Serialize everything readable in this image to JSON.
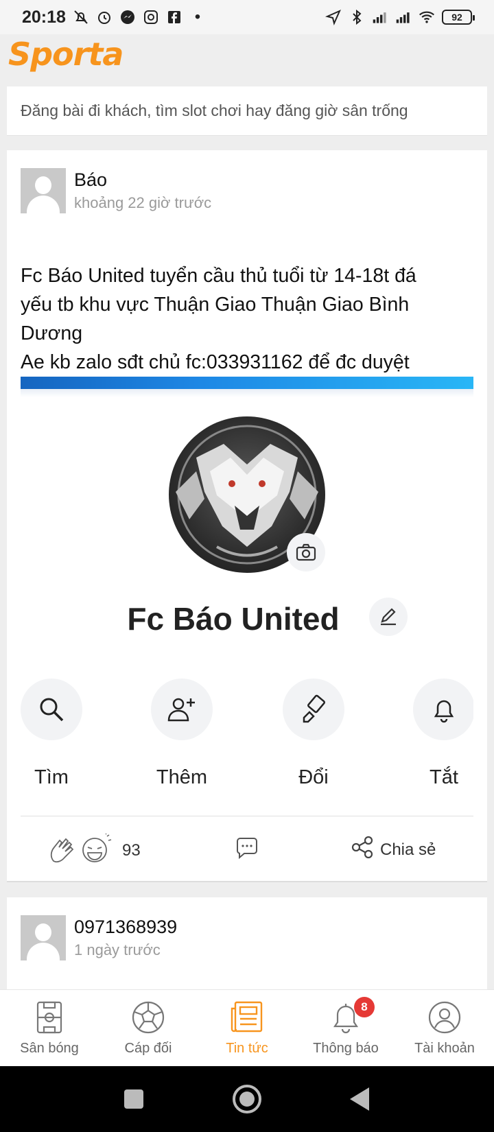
{
  "status_bar": {
    "time": "20:18",
    "battery": "92"
  },
  "app": {
    "logo": "Sporta"
  },
  "composer": {
    "placeholder": "Đăng bài đi khách, tìm slot chơi hay đăng giờ sân trống"
  },
  "posts": [
    {
      "author": "Báo",
      "time_ago": "khoảng 22 giờ trước",
      "text_lines": [
        "Fc Báo United tuyển cầu thủ tuổi từ 14-18t đá",
        "yếu tb khu vực Thuận Giao Thuận Giao Bình",
        "Dương",
        "Ae kb zalo sđt chủ fc:033931162 để đc duyệt"
      ],
      "image": {
        "group_name": "Fc Báo United",
        "actions": [
          "Tìm",
          "Thêm",
          "Đổi",
          "Tắt"
        ]
      },
      "reaction_count": "93",
      "share_label": "Chia sẻ"
    },
    {
      "author": "0971368939",
      "time_ago": "1 ngày trước"
    }
  ],
  "bottom_nav": {
    "items": [
      "Sân bóng",
      "Cáp đối",
      "Tin tức",
      "Thông báo",
      "Tài khoản"
    ],
    "active": "Tin tức",
    "notification_badge": "8"
  },
  "colors": {
    "brand": "#f7941d",
    "badge": "#e53935"
  }
}
